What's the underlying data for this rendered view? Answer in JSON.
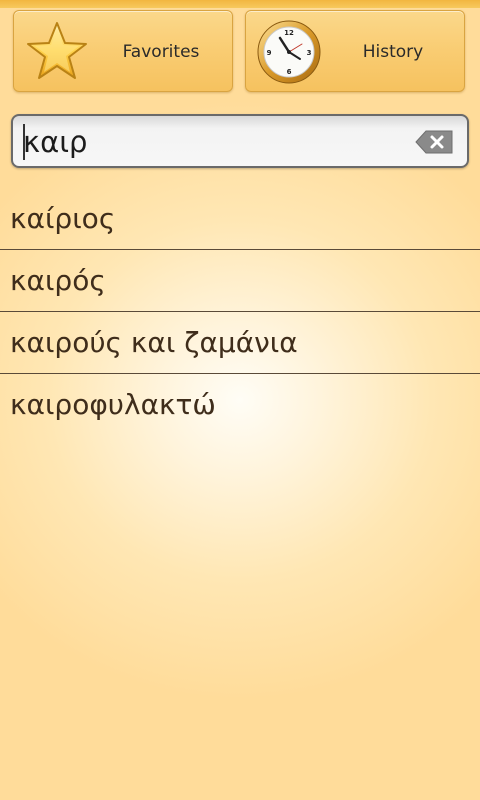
{
  "header": {
    "favorites_label": "Favorites",
    "history_label": "History",
    "favorites_icon": "star-icon",
    "history_icon": "clock-icon"
  },
  "search": {
    "value": "καιρ",
    "clear_icon": "backspace-clear-icon"
  },
  "results": [
    {
      "text": "καίριος"
    },
    {
      "text": "καιρός"
    },
    {
      "text": "καιρούς και ζαμάνια"
    },
    {
      "text": "καιροφυλακτώ"
    }
  ],
  "colors": {
    "button_gradient_top": "#fbd88b",
    "button_gradient_bottom": "#f6c25f",
    "background_center": "#fffdf6",
    "background_edge": "#ffdc9a",
    "result_text": "#3f2d1b"
  }
}
